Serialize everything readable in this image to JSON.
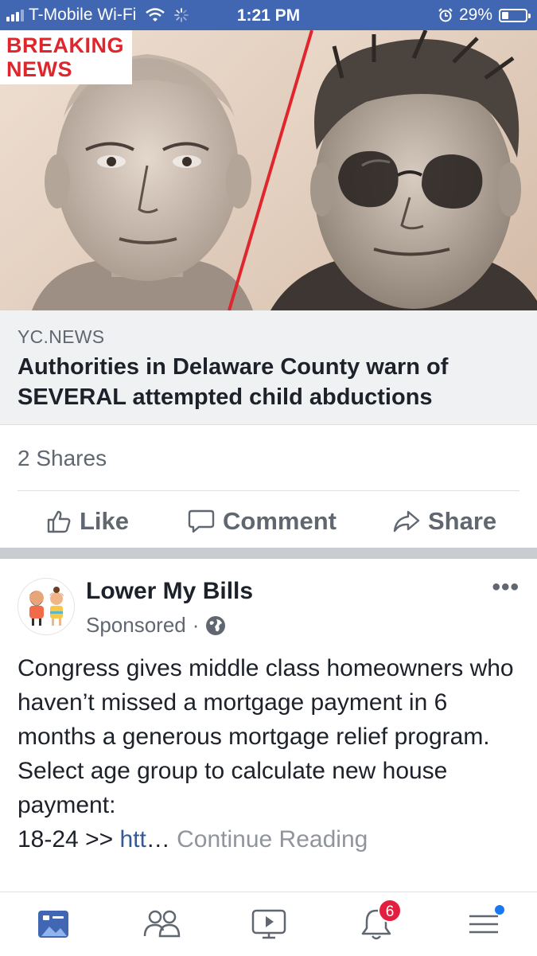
{
  "status_bar": {
    "carrier": "T-Mobile Wi-Fi",
    "time": "1:21 PM",
    "battery": "29%",
    "battery_level": 0.29,
    "icons": [
      "signal-icon",
      "wifi-icon",
      "loading-icon",
      "alarm-icon",
      "battery-icon"
    ]
  },
  "post": {
    "image_badge": "BREAKING NEWS",
    "image_badge_line1": "BREAKING",
    "image_badge_line2": "NEWS",
    "link_domain": "YC.NEWS",
    "headline": "Authorities in Delaware County warn of SEVERAL attempted child abductions",
    "shares": "2 Shares",
    "actions": {
      "like": "Like",
      "comment": "Comment",
      "share": "Share"
    }
  },
  "ad": {
    "page_name": "Lower My Bills",
    "sponsored": "Sponsored",
    "body": "Congress gives middle class homeowners who haven’t missed a mortgage payment in 6 months a generous mortgage relief program. Select age group to calculate new house payment:",
    "link_prefix": "18-24 >> ",
    "link_text": "htt",
    "ellipsis": "…",
    "continue": " Continue Reading"
  },
  "tab_bar": {
    "items": [
      "news-feed-icon",
      "friends-icon",
      "watch-icon",
      "notifications-icon",
      "menu-icon"
    ],
    "notification_count": "6"
  },
  "colors": {
    "facebook_blue": "#4267b2",
    "badge_red": "#e0262d",
    "link_blue": "#365899",
    "notification_red": "#e41e3f"
  }
}
